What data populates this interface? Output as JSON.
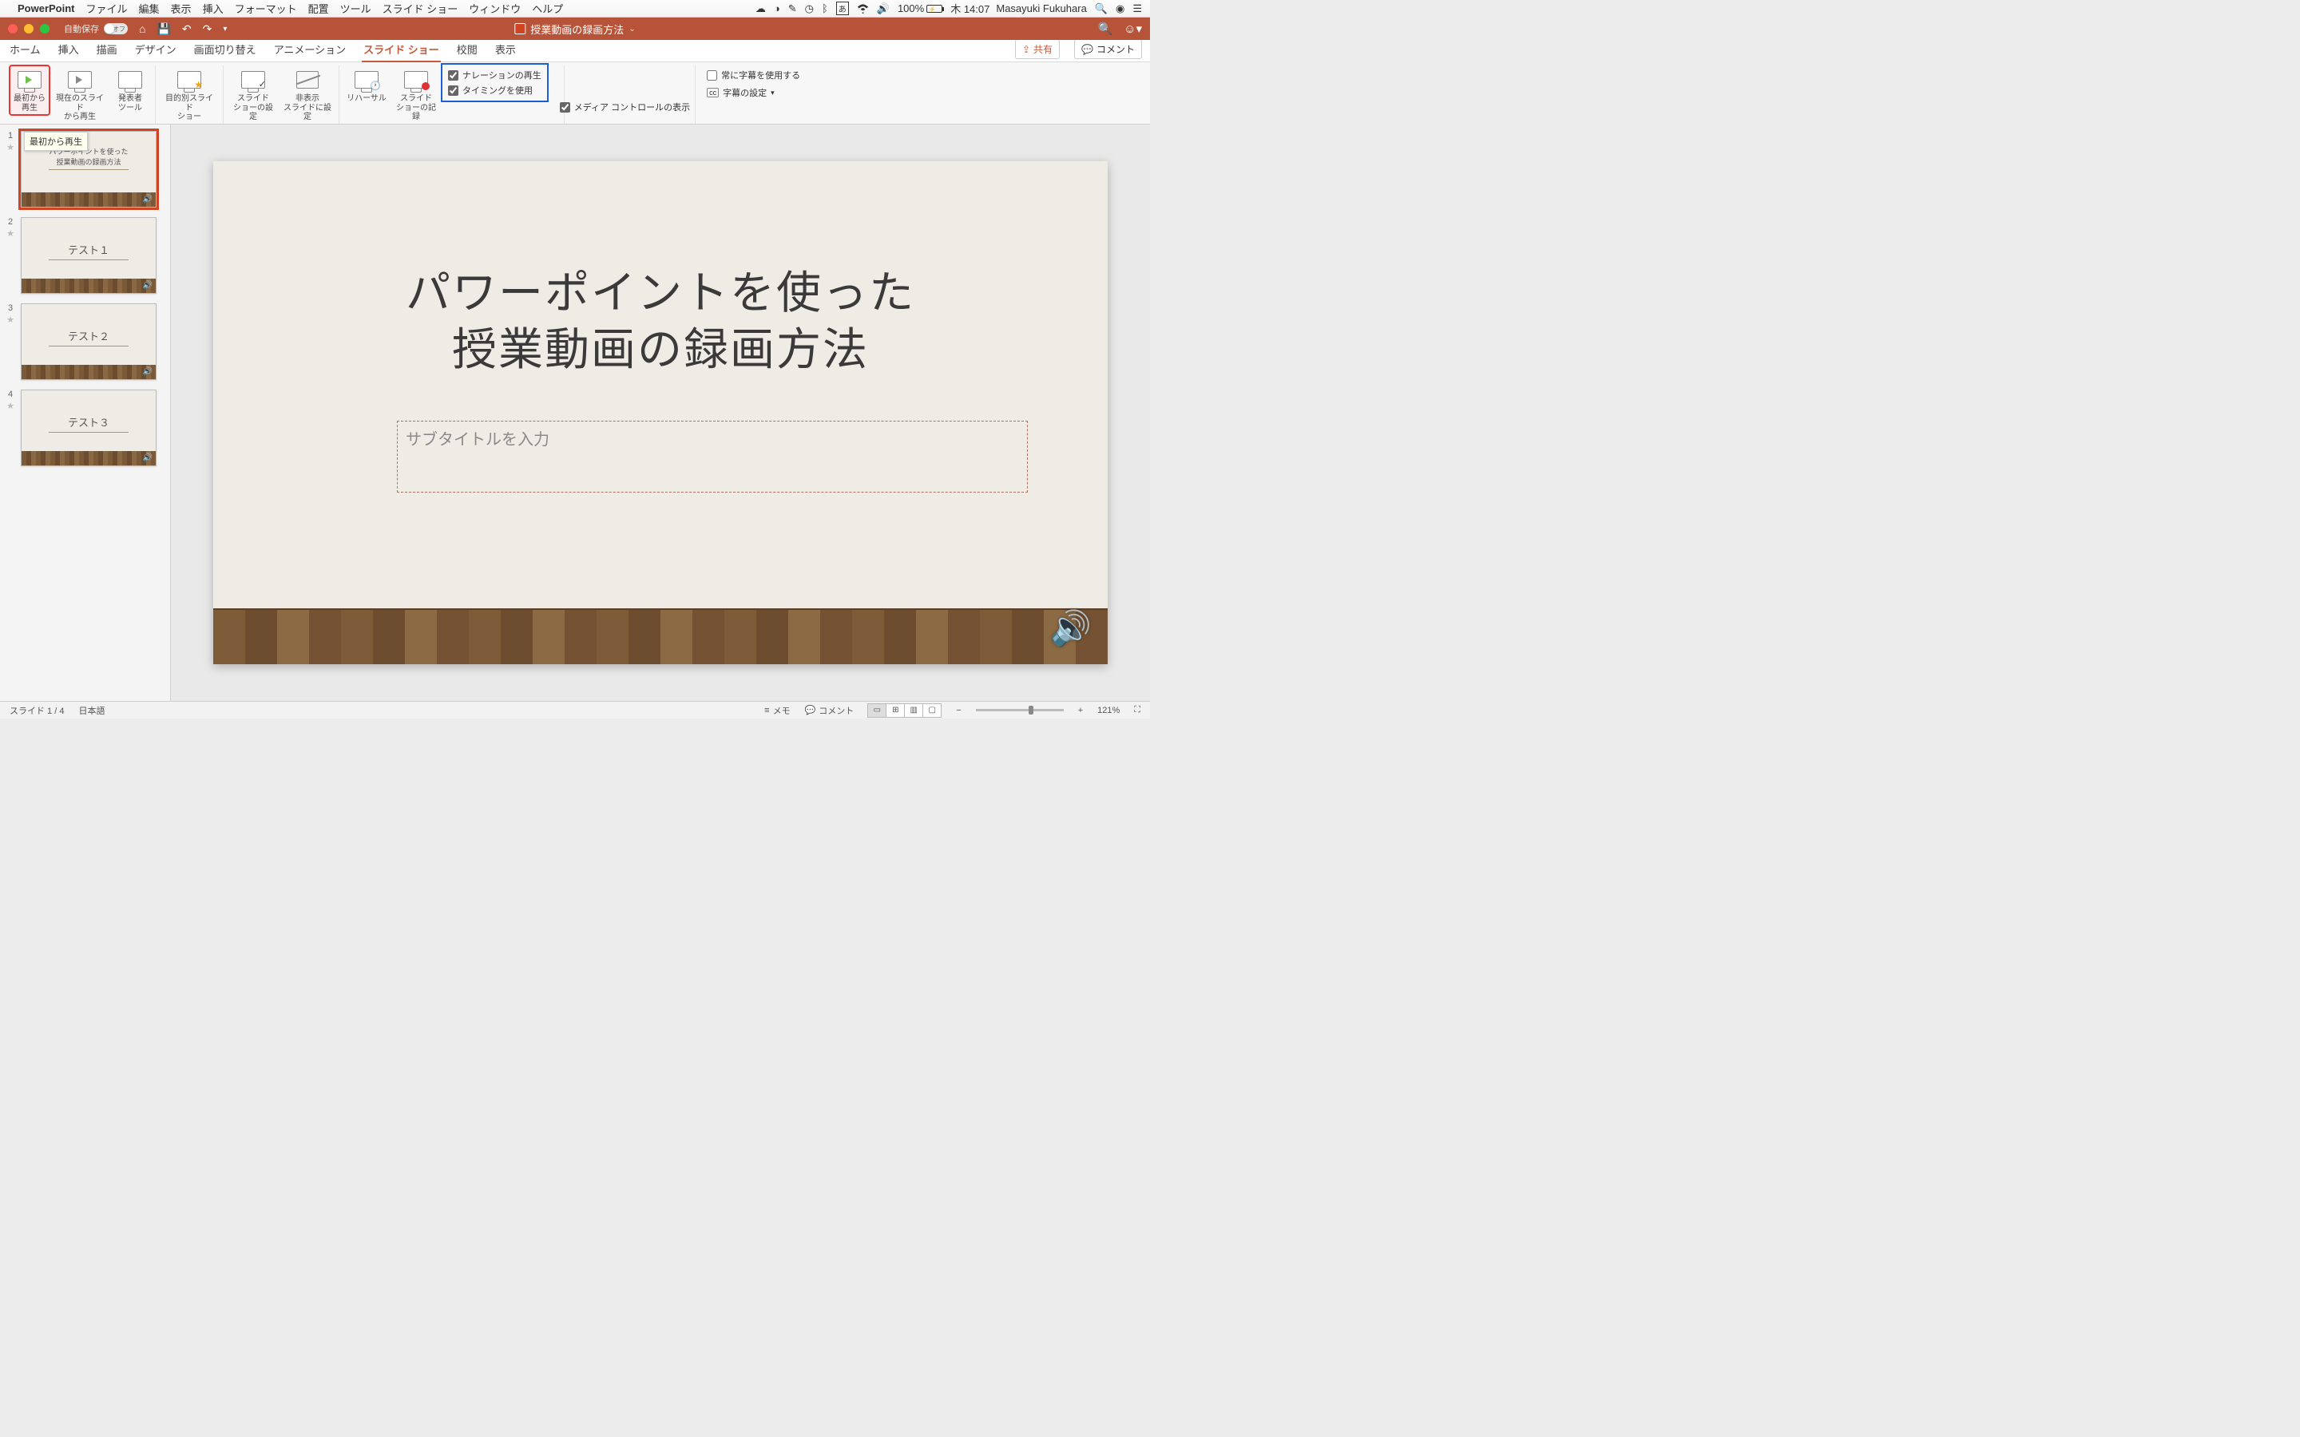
{
  "menubar": {
    "app": "PowerPoint",
    "items": [
      "ファイル",
      "編集",
      "表示",
      "挿入",
      "フォーマット",
      "配置",
      "ツール",
      "スライド ショー",
      "ウィンドウ",
      "ヘルプ"
    ],
    "battery": "100%",
    "clock": "木 14:07",
    "user": "Masayuki Fukuhara"
  },
  "titlebar": {
    "autosave_label": "自動保存",
    "autosave_state": "オフ",
    "doc_title": "授業動画の録画方法"
  },
  "tabs": [
    "ホーム",
    "挿入",
    "描画",
    "デザイン",
    "画面切り替え",
    "アニメーション",
    "スライド ショー",
    "校閲",
    "表示"
  ],
  "active_tab": "スライド ショー",
  "share_label": "共有",
  "comments_label": "コメント",
  "ribbon": {
    "from_beginning": "最初から\n再生",
    "from_current": "現在のスライド\nから再生",
    "presenter": "発表者\nツール",
    "custom": "目的別スライド\nショー",
    "setup": "スライド\nショーの設定",
    "hide": "非表示\nスライドに設定",
    "rehearse": "リハーサル",
    "record": "スライド\nショーの記録",
    "chk_narration": "ナレーションの再生",
    "chk_timing": "タイミングを使用",
    "chk_media": "メディア コントロールの表示",
    "chk_subtitle_always": "常に字幕を使用する",
    "subtitle_settings": "字幕の設定"
  },
  "tooltip": "最初から再生",
  "thumbnails": [
    {
      "num": "1",
      "title_l1": "パワーポイントを使った",
      "title_l2": "授業動画の録画方法",
      "selected": true
    },
    {
      "num": "2",
      "title_l1": "テスト１",
      "title_l2": "",
      "selected": false
    },
    {
      "num": "3",
      "title_l1": "テスト２",
      "title_l2": "",
      "selected": false
    },
    {
      "num": "4",
      "title_l1": "テスト３",
      "title_l2": "",
      "selected": false
    }
  ],
  "slide": {
    "title_l1": "パワーポイントを使った",
    "title_l2": "授業動画の録画方法",
    "subtitle_placeholder": "サブタイトルを入力"
  },
  "status": {
    "slide_counter": "スライド 1 / 4",
    "language": "日本語",
    "notes": "メモ",
    "comments": "コメント",
    "zoom": "121%"
  }
}
